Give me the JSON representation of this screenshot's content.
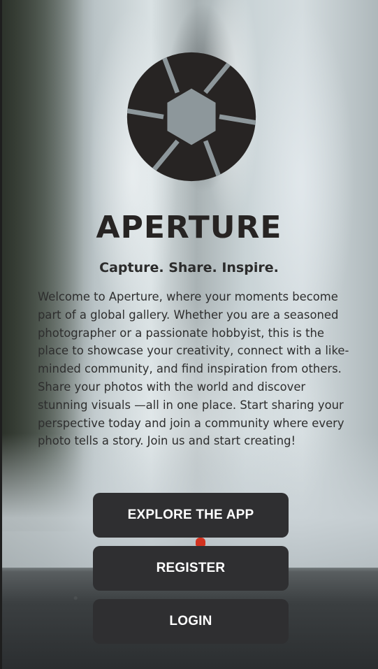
{
  "app": {
    "name": "APERTURE",
    "tagline": "Capture. Share. Inspire.",
    "intro": "Welcome to Aperture, where your moments become part of a global gallery. Whether you are a seasoned photographer or a passionate hobbyist, this is the place to showcase your creativity, connect with a like-minded community, and find inspiration from others. Share your photos with the world and discover stunning visuals —all in one place. Start sharing your perspective today and join a community where every photo tells a story. Join us and start creating!",
    "logo_icon": "aperture-shutter-icon"
  },
  "actions": {
    "explore_label": "EXPLORE THE APP",
    "register_label": "REGISTER",
    "login_label": "LOGIN"
  },
  "colors": {
    "logo": "#272423",
    "button_bg": "#2f2f31",
    "button_text": "#ffffff",
    "heading_text": "#272423",
    "body_text": "#2e2e2e"
  }
}
